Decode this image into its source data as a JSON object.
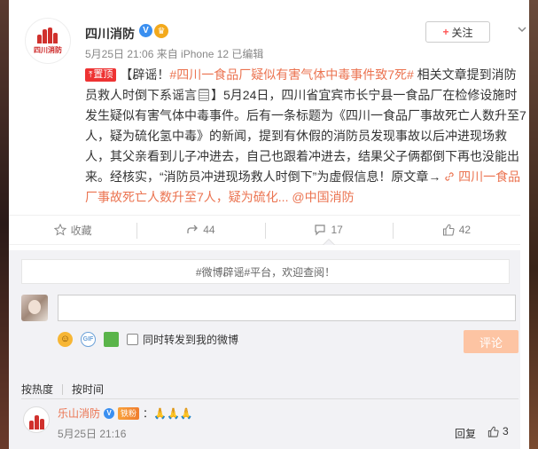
{
  "post": {
    "author": "四川消防",
    "avatar_logo_text": "四川消防",
    "meta": "5月25日 21:06 来自 iPhone 12  已编辑",
    "follow_label": "关注",
    "pin_label": "置顶",
    "text_prefix": "【辟谣！",
    "topic": "#四川一食品厂疑似有害气体中毒事件致7死#",
    "text_1": " 相关文章提到消防员救人时倒下系谣言",
    "text_2": "】5月24日，四川省宜宾市长宁县一食品厂在检修设施时发生疑似有害气体中毒事件。后有一条标题为《四川一食品厂事故死亡人数升至7人，疑为硫化氢中毒》的新闻，提到有休假的消防员发现事故以后冲进现场救人，其父亲看到儿子冲进去，自己也跟着冲进去，结果父子俩都倒下再也没能出来。经核实，“消防员冲进现场救人时倒下”为虚假信息！原文章→ ",
    "link_text": "四川一食品厂事故死亡人数升至7人，疑为硫化...",
    "mention": "@中国消防"
  },
  "actions": {
    "favorite": "收藏",
    "forward": "44",
    "comment": "17",
    "like": "42"
  },
  "comment_box": {
    "notice": "#微博辟谣#平台，欢迎查阅！",
    "also_forward": "同时转发到我的微博",
    "submit": "评论",
    "gif_label": "GIF"
  },
  "sort": {
    "hot": "按热度",
    "time": "按时间"
  },
  "comments": [
    {
      "author": "乐山消防",
      "fan_badge": "铁粉",
      "text": "：🙏🙏🙏",
      "time": "5月25日 21:16",
      "reply": "回复",
      "likes": "3"
    }
  ],
  "colors": {
    "accent": "#eb7350",
    "verified": "#3a8ff0",
    "pin": "#e33333",
    "submit_disabled": "#fdc4a3"
  }
}
